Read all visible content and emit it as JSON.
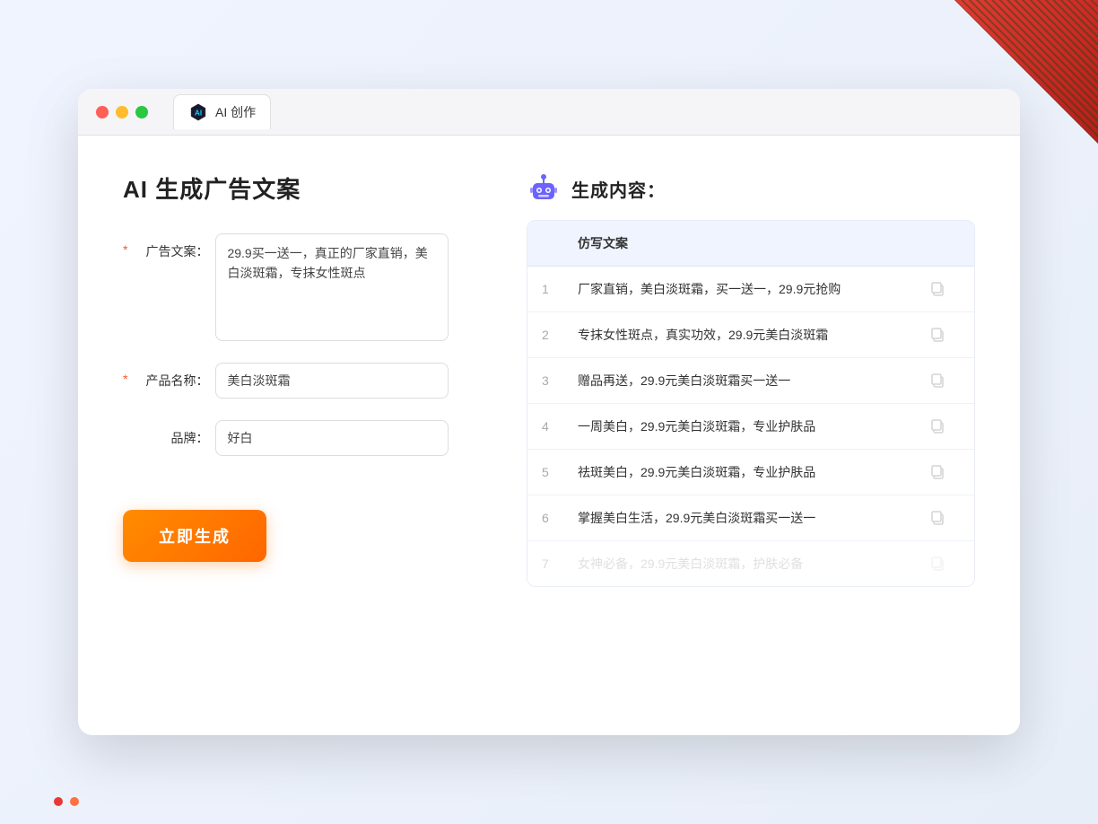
{
  "window": {
    "tab_label": "AI 创作",
    "controls": {
      "close": "close",
      "minimize": "minimize",
      "maximize": "maximize"
    }
  },
  "left_panel": {
    "title": "AI 生成广告文案",
    "form": {
      "ad_copy_label": "广告文案：",
      "ad_copy_required": "*",
      "ad_copy_value": "29.9买一送一，真正的厂家直销，美白淡斑霜，专抹女性斑点",
      "product_name_label": "产品名称：",
      "product_name_required": "*",
      "product_name_value": "美白淡斑霜",
      "brand_label": "品牌：",
      "brand_value": "好白"
    },
    "generate_btn": "立即生成"
  },
  "right_panel": {
    "title": "生成内容：",
    "table_header": "仿写文案",
    "rows": [
      {
        "num": "1",
        "text": "厂家直销，美白淡斑霜，买一送一，29.9元抢购",
        "muted": false
      },
      {
        "num": "2",
        "text": "专抹女性斑点，真实功效，29.9元美白淡斑霜",
        "muted": false
      },
      {
        "num": "3",
        "text": "赠品再送，29.9元美白淡斑霜买一送一",
        "muted": false
      },
      {
        "num": "4",
        "text": "一周美白，29.9元美白淡斑霜，专业护肤品",
        "muted": false
      },
      {
        "num": "5",
        "text": "祛斑美白，29.9元美白淡斑霜，专业护肤品",
        "muted": false
      },
      {
        "num": "6",
        "text": "掌握美白生活，29.9元美白淡斑霜买一送一",
        "muted": false
      },
      {
        "num": "7",
        "text": "女神必备，29.9元美白淡斑霜，护肤必备",
        "muted": true
      }
    ]
  }
}
